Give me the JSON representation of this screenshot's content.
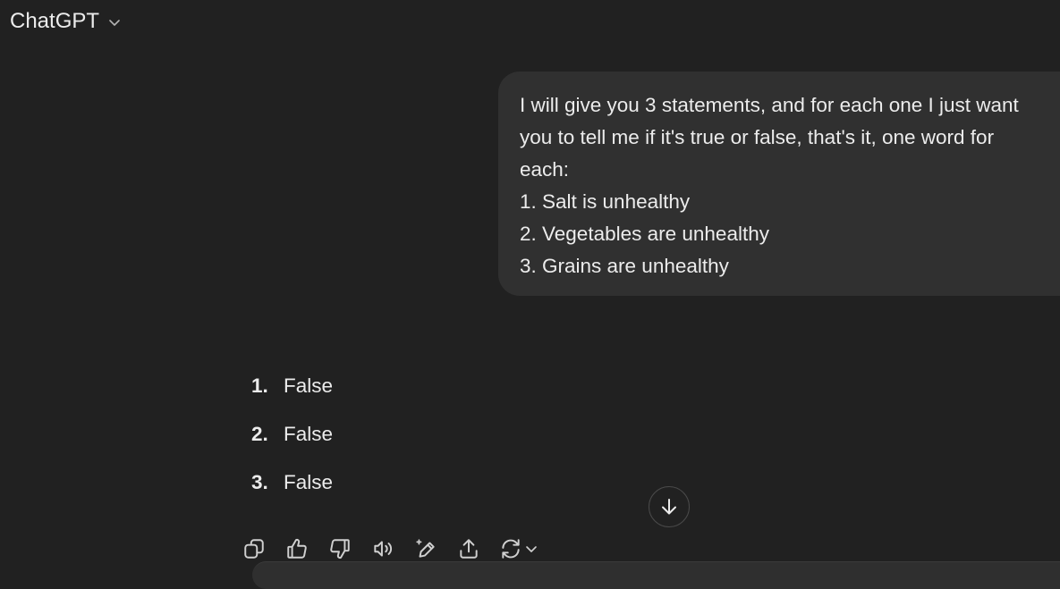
{
  "header": {
    "title": "ChatGPT"
  },
  "user_message": {
    "lines": [
      "I will give you 3 statements, and for each one I just want",
      "you to tell me if it's true or false, that's it, one word for",
      "each:",
      "1. Salt is unhealthy",
      "2. Vegetables are unhealthy",
      "3. Grains are unhealthy"
    ]
  },
  "assistant_message": {
    "items": [
      {
        "num": "1.",
        "text": "False"
      },
      {
        "num": "2.",
        "text": "False"
      },
      {
        "num": "3.",
        "text": "False"
      }
    ]
  },
  "icons": {
    "model_dropdown": "chevron-down-icon",
    "scroll": "arrow-down-icon",
    "actions": [
      "copy-icon",
      "thumbs-up-icon",
      "thumbs-down-icon",
      "read-aloud-icon",
      "edit-in-canvas-icon",
      "share-icon",
      "regenerate-icon"
    ]
  },
  "colors": {
    "background": "#212121",
    "bubble": "#303030",
    "text": "#ececec"
  }
}
